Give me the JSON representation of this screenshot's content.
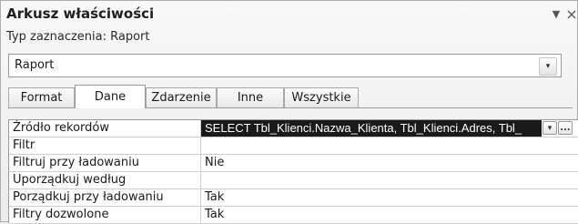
{
  "title": "Arkusz właściwości",
  "title_buttons": {
    "dropdown_icon": "▼",
    "close_icon": "×"
  },
  "selection_type": "Typ zaznaczenia:  Raport",
  "object_combo": {
    "value": "Raport",
    "arrow": "▾"
  },
  "tabs": [
    {
      "label": "Format",
      "active": false
    },
    {
      "label": "Dane",
      "active": true
    },
    {
      "label": "Zdarzenie",
      "active": false
    },
    {
      "label": "Inne",
      "active": false
    },
    {
      "label": "Wszystkie",
      "active": false
    }
  ],
  "properties": [
    {
      "name": "Źródło rekordów",
      "value": "SELECT Tbl_Klienci.Nazwa_Klienta, Tbl_Klienci.Adres, Tbl_"
    },
    {
      "name": "Filtr",
      "value": ""
    },
    {
      "name": "Filtruj przy ładowaniu",
      "value": "Nie"
    },
    {
      "name": "Uporządkuj według",
      "value": ""
    },
    {
      "name": "Porządkuj przy ładowaniu",
      "value": "Tak"
    },
    {
      "name": "Filtry dozwolone",
      "value": "Tak"
    }
  ],
  "row_buttons": {
    "dropdown": "▾",
    "builder": "..."
  }
}
